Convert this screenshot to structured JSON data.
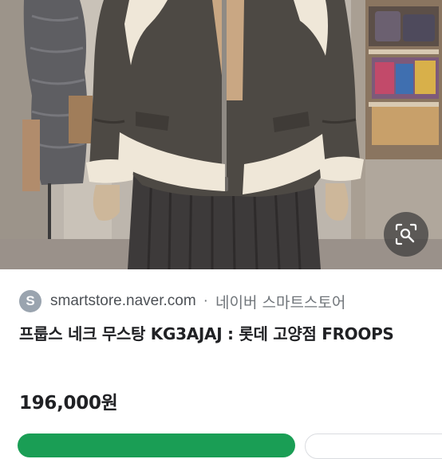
{
  "result": {
    "source_initial": "S",
    "source_domain": "smartstore.naver.com",
    "source_separator": "·",
    "source_name": "네이버 스마트스토어",
    "title": "프룹스 네크 무스탕 KG3AJAJ : 롯데 고양점 FROOPS",
    "price": "196,000원"
  },
  "photo": {
    "subject": "shearling-jacket-on-mannequin"
  },
  "icons": {
    "lens": "image-search-icon"
  },
  "colors": {
    "buy_button": "#1a9e55",
    "badge": "#9aa4af",
    "jacket": "#4d4944",
    "shearling": "#efe7d8"
  }
}
